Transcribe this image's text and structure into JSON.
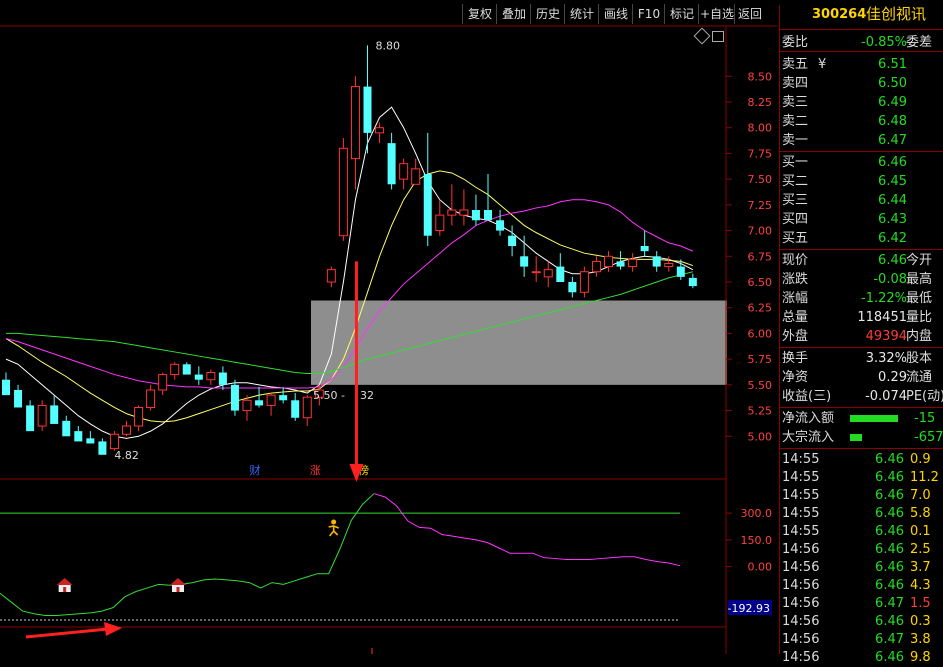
{
  "toolbar": {
    "buttons": [
      "复权",
      "叠加",
      "历史",
      "统计",
      "画线",
      "F10",
      "标记",
      "+自选",
      "返回"
    ]
  },
  "stock": {
    "code": "300264",
    "name": "佳创视讯"
  },
  "quote": {
    "wei_bi": {
      "label": "委比",
      "value": "-0.85%",
      "label2": "委差"
    },
    "sell": [
      {
        "label": "卖五",
        "price": "6.51"
      },
      {
        "label": "卖四",
        "price": "6.50"
      },
      {
        "label": "卖三",
        "price": "6.49"
      },
      {
        "label": "卖二",
        "price": "6.48"
      },
      {
        "label": "卖一",
        "price": "6.47"
      }
    ],
    "buy": [
      {
        "label": "买一",
        "price": "6.46"
      },
      {
        "label": "买二",
        "price": "6.45"
      },
      {
        "label": "买三",
        "price": "6.44"
      },
      {
        "label": "买四",
        "price": "6.43"
      },
      {
        "label": "买五",
        "price": "6.42"
      }
    ],
    "stats": [
      {
        "label": "现价",
        "value": "6.46",
        "label2": "今开",
        "color": "green"
      },
      {
        "label": "涨跌",
        "value": "-0.08",
        "label2": "最高",
        "color": "green"
      },
      {
        "label": "涨幅",
        "value": "-1.22%",
        "label2": "最低",
        "color": "green"
      },
      {
        "label": "总量",
        "value": "118451",
        "label2": "量比",
        "color": "white"
      },
      {
        "label": "外盘",
        "value": "49394",
        "label2": "内盘",
        "color": "red"
      }
    ],
    "stats2": [
      {
        "label": "换手",
        "value": "3.32%",
        "label2": "股本"
      },
      {
        "label": "净资",
        "value": "0.29",
        "label2": "流通"
      },
      {
        "label": "收益(三)",
        "value": "-0.074",
        "label2": "PE(动)"
      }
    ],
    "flows": [
      {
        "label": "净流入额",
        "value": "-15",
        "bar": 0.85
      },
      {
        "label": "大宗流入",
        "value": "-657",
        "bar": 0.22
      }
    ],
    "ticks": [
      {
        "time": "14:55",
        "price": "6.46",
        "vol": "0.9",
        "vcolor": "yellow"
      },
      {
        "time": "14:55",
        "price": "6.46",
        "vol": "11.2",
        "vcolor": "yellow"
      },
      {
        "time": "14:55",
        "price": "6.46",
        "vol": "7.0",
        "vcolor": "yellow"
      },
      {
        "time": "14:55",
        "price": "6.46",
        "vol": "5.8",
        "vcolor": "yellow"
      },
      {
        "time": "14:55",
        "price": "6.46",
        "vol": "0.1",
        "vcolor": "yellow"
      },
      {
        "time": "14:56",
        "price": "6.46",
        "vol": "2.5",
        "vcolor": "yellow"
      },
      {
        "time": "14:56",
        "price": "6.46",
        "vol": "3.7",
        "vcolor": "yellow"
      },
      {
        "time": "14:56",
        "price": "6.46",
        "vol": "4.3",
        "vcolor": "yellow"
      },
      {
        "time": "14:56",
        "price": "6.47",
        "vol": "1.5",
        "vcolor": "red"
      },
      {
        "time": "14:56",
        "price": "6.46",
        "vol": "0.3",
        "vcolor": "yellow"
      },
      {
        "time": "14:56",
        "price": "6.47",
        "vol": "3.8",
        "vcolor": "yellow"
      },
      {
        "time": "14:56",
        "price": "6.46",
        "vol": "9.8",
        "vcolor": "yellow"
      }
    ]
  },
  "chart_data": [
    {
      "type": "candlestick",
      "yticks": [
        5.0,
        5.25,
        5.5,
        5.75,
        6.0,
        6.25,
        6.5,
        6.75,
        7.0,
        7.25,
        7.5,
        7.75,
        8.0,
        8.25,
        8.5
      ],
      "ylim": [
        4.75,
        8.95
      ],
      "annotations": {
        "high": "8.80",
        "low": "4.82",
        "box_label_left": "5.50",
        "box_label_right": "32"
      },
      "box": {
        "low": 5.5,
        "high": 6.32
      },
      "markers": [
        {
          "label": "财",
          "index": 20,
          "color": "#3366ff"
        },
        {
          "label": "涨",
          "index": 25,
          "color": "#ff3333"
        },
        {
          "label": "榜",
          "index": 29,
          "color": "#ffd400"
        }
      ],
      "candles": [
        [
          5.55,
          5.62,
          5.45,
          5.4
        ],
        [
          5.45,
          5.5,
          5.3,
          5.28
        ],
        [
          5.3,
          5.35,
          5.1,
          5.05
        ],
        [
          5.1,
          5.35,
          5.05,
          5.3
        ],
        [
          5.3,
          5.4,
          5.15,
          5.12
        ],
        [
          5.15,
          5.2,
          5.02,
          5.0
        ],
        [
          5.05,
          5.1,
          4.98,
          4.95
        ],
        [
          4.98,
          5.05,
          4.95,
          4.93
        ],
        [
          4.95,
          4.98,
          4.88,
          4.82
        ],
        [
          4.88,
          5.05,
          4.86,
          5.02
        ],
        [
          5.02,
          5.15,
          5.0,
          5.1
        ],
        [
          5.1,
          5.3,
          5.05,
          5.28
        ],
        [
          5.28,
          5.5,
          5.25,
          5.45
        ],
        [
          5.45,
          5.62,
          5.4,
          5.6
        ],
        [
          5.6,
          5.72,
          5.55,
          5.7
        ],
        [
          5.7,
          5.72,
          5.62,
          5.6
        ],
        [
          5.6,
          5.68,
          5.5,
          5.55
        ],
        [
          5.55,
          5.65,
          5.5,
          5.62
        ],
        [
          5.62,
          5.68,
          5.45,
          5.5
        ],
        [
          5.5,
          5.55,
          5.2,
          5.25
        ],
        [
          5.25,
          5.4,
          5.15,
          5.35
        ],
        [
          5.35,
          5.48,
          5.28,
          5.3
        ],
        [
          5.3,
          5.42,
          5.2,
          5.4
        ],
        [
          5.4,
          5.48,
          5.32,
          5.35
        ],
        [
          5.35,
          5.42,
          5.15,
          5.18
        ],
        [
          5.18,
          5.4,
          5.1,
          5.38
        ],
        [
          5.38,
          5.5,
          5.3,
          5.45
        ],
        [
          6.5,
          6.65,
          6.45,
          6.62
        ],
        [
          6.95,
          7.9,
          6.9,
          7.8
        ],
        [
          7.7,
          8.5,
          7.4,
          8.4
        ],
        [
          8.4,
          8.8,
          7.75,
          7.95
        ],
        [
          7.95,
          8.05,
          7.85,
          8.0
        ],
        [
          7.85,
          7.95,
          7.4,
          7.45
        ],
        [
          7.5,
          7.7,
          7.4,
          7.65
        ],
        [
          7.45,
          7.7,
          7.45,
          7.6
        ],
        [
          7.55,
          7.95,
          6.85,
          6.95
        ],
        [
          7.0,
          7.3,
          6.95,
          7.15
        ],
        [
          7.15,
          7.45,
          7.05,
          7.2
        ],
        [
          7.15,
          7.4,
          7.05,
          7.2
        ],
        [
          7.2,
          7.35,
          7.05,
          7.1
        ],
        [
          7.2,
          7.55,
          7.1,
          7.1
        ],
        [
          7.1,
          7.2,
          6.95,
          7.0
        ],
        [
          6.95,
          7.05,
          6.75,
          6.85
        ],
        [
          6.75,
          6.95,
          6.55,
          6.65
        ],
        [
          6.6,
          6.75,
          6.5,
          6.6
        ],
        [
          6.55,
          6.7,
          6.45,
          6.62
        ],
        [
          6.65,
          6.78,
          6.5,
          6.5
        ],
        [
          6.5,
          6.55,
          6.35,
          6.4
        ],
        [
          6.4,
          6.65,
          6.35,
          6.6
        ],
        [
          6.6,
          6.75,
          6.55,
          6.7
        ],
        [
          6.65,
          6.8,
          6.6,
          6.75
        ],
        [
          6.7,
          6.8,
          6.62,
          6.65
        ],
        [
          6.65,
          6.78,
          6.6,
          6.72
        ],
        [
          6.85,
          7.0,
          6.75,
          6.8
        ],
        [
          6.75,
          6.8,
          6.6,
          6.65
        ],
        [
          6.65,
          6.75,
          6.6,
          6.68
        ],
        [
          6.65,
          6.72,
          6.52,
          6.55
        ],
        [
          6.54,
          6.58,
          6.44,
          6.46
        ]
      ],
      "ma_white": [
        5.75,
        5.7,
        5.6,
        5.5,
        5.4,
        5.3,
        5.2,
        5.12,
        5.05,
        5.0,
        4.98,
        5.0,
        5.05,
        5.12,
        5.22,
        5.32,
        5.4,
        5.46,
        5.5,
        5.52,
        5.52,
        5.5,
        5.48,
        5.47,
        5.45,
        5.42,
        5.5,
        5.8,
        6.5,
        7.3,
        7.85,
        8.1,
        8.2,
        8.0,
        7.75,
        7.48,
        7.3,
        7.2,
        7.15,
        7.12,
        7.1,
        7.05,
        6.98,
        6.88,
        6.78,
        6.7,
        6.62,
        6.58,
        6.58,
        6.6,
        6.65,
        6.7,
        6.73,
        6.75,
        6.74,
        6.72,
        6.68,
        6.62
      ],
      "ma_yellow": [
        5.95,
        5.88,
        5.8,
        5.72,
        5.65,
        5.58,
        5.5,
        5.42,
        5.35,
        5.28,
        5.22,
        5.18,
        5.15,
        5.14,
        5.15,
        5.18,
        5.22,
        5.26,
        5.3,
        5.34,
        5.37,
        5.4,
        5.42,
        5.43,
        5.44,
        5.44,
        5.46,
        5.55,
        5.75,
        6.05,
        6.4,
        6.75,
        7.05,
        7.3,
        7.48,
        7.55,
        7.58,
        7.56,
        7.5,
        7.42,
        7.35,
        7.25,
        7.15,
        7.05,
        6.98,
        6.92,
        6.86,
        6.82,
        6.78,
        6.76,
        6.74,
        6.73,
        6.72,
        6.72,
        6.72,
        6.71,
        6.7,
        6.66
      ],
      "ma_magenta": [
        5.95,
        5.92,
        5.88,
        5.84,
        5.8,
        5.76,
        5.72,
        5.68,
        5.64,
        5.6,
        5.57,
        5.54,
        5.52,
        5.5,
        5.49,
        5.48,
        5.48,
        5.47,
        5.47,
        5.47,
        5.47,
        5.47,
        5.47,
        5.47,
        5.47,
        5.47,
        5.48,
        5.55,
        5.68,
        5.85,
        6.05,
        6.22,
        6.35,
        6.48,
        6.58,
        6.68,
        6.78,
        6.88,
        6.96,
        7.05,
        7.1,
        7.14,
        7.17,
        7.19,
        7.22,
        7.24,
        7.28,
        7.3,
        7.3,
        7.28,
        7.25,
        7.18,
        7.08,
        7.0,
        6.94,
        6.88,
        6.85,
        6.8
      ],
      "ma_green": [
        6.0,
        6.0,
        5.99,
        5.98,
        5.97,
        5.96,
        5.95,
        5.94,
        5.93,
        5.92,
        5.9,
        5.88,
        5.86,
        5.84,
        5.82,
        5.8,
        5.78,
        5.76,
        5.74,
        5.72,
        5.7,
        5.68,
        5.66,
        5.64,
        5.62,
        5.61,
        5.61,
        5.63,
        5.67,
        5.71,
        5.75,
        5.78,
        5.81,
        5.84,
        5.87,
        5.9,
        5.93,
        5.96,
        5.99,
        6.02,
        6.05,
        6.08,
        6.11,
        6.14,
        6.17,
        6.2,
        6.23,
        6.26,
        6.29,
        6.32,
        6.35,
        6.38,
        6.42,
        6.46,
        6.5,
        6.54,
        6.57,
        6.6
      ]
    },
    {
      "type": "line",
      "yticks": [
        300.0,
        150.0,
        0.0
      ],
      "ylim": [
        -300,
        430
      ],
      "last_value": "-192.93",
      "hline": 300,
      "signal_index": 29,
      "home_markers": [
        5,
        15
      ],
      "values": [
        -150,
        -200,
        -250,
        -265,
        -275,
        -275,
        -270,
        -265,
        -260,
        -250,
        -230,
        -170,
        -140,
        -120,
        -100,
        -105,
        -100,
        -90,
        -75,
        -70,
        -75,
        -80,
        -90,
        -120,
        -90,
        -100,
        -80,
        -60,
        -40,
        -40,
        100,
        260,
        350,
        410,
        390,
        340,
        255,
        220,
        215,
        180,
        170,
        160,
        150,
        135,
        105,
        75,
        75,
        75,
        50,
        45,
        40,
        40,
        40,
        45,
        50,
        55,
        55,
        40,
        28,
        20,
        5
      ]
    }
  ]
}
